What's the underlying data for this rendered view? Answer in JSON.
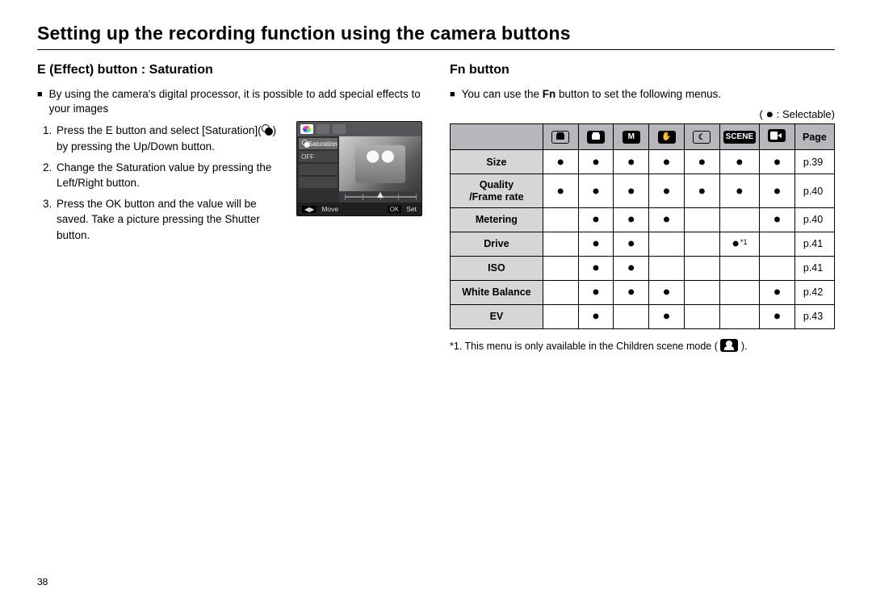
{
  "title": "Setting up the recording function using the camera buttons",
  "left": {
    "heading": "E (Effect) button : Saturation",
    "intro": "By using the camera's digital processor, it is possible to add special effects to your images",
    "steps": [
      "Press the E button and select [Saturation](   ) by pressing the Up/Down button.",
      "Change the Saturation value by pressing the Left/Right button.",
      "Press the OK button and the value will be saved. Take a picture pressing the Shutter button."
    ],
    "lcd": {
      "menu_label": "Saturation",
      "off_label": "OFF",
      "move_label": "Move",
      "ok_label": "OK",
      "set_label": "Set"
    }
  },
  "right": {
    "heading": "Fn button",
    "intro_pre": "You can use the ",
    "intro_bold": "Fn",
    "intro_post": " button to set the following menus.",
    "legend_label": " : Selectable",
    "page_label": "Page",
    "mode_icons": [
      "auto",
      "program",
      "manual",
      "dis",
      "night",
      "scene",
      "movie"
    ],
    "rows": [
      {
        "label": "Size",
        "dots": [
          true,
          true,
          true,
          true,
          true,
          true,
          true
        ],
        "page": "p.39"
      },
      {
        "label": "Quality\n/Frame rate",
        "dots": [
          true,
          true,
          true,
          true,
          true,
          true,
          true
        ],
        "page": "p.40"
      },
      {
        "label": "Metering",
        "dots": [
          false,
          true,
          true,
          true,
          false,
          false,
          true
        ],
        "page": "p.40"
      },
      {
        "label": "Drive",
        "dots": [
          false,
          true,
          true,
          false,
          false,
          "*1",
          false
        ],
        "page": "p.41"
      },
      {
        "label": "ISO",
        "dots": [
          false,
          true,
          true,
          false,
          false,
          false,
          false
        ],
        "page": "p.41"
      },
      {
        "label": "White Balance",
        "dots": [
          false,
          true,
          true,
          true,
          false,
          false,
          true
        ],
        "page": "p.42"
      },
      {
        "label": "EV",
        "dots": [
          false,
          true,
          false,
          true,
          false,
          false,
          true
        ],
        "page": "p.43"
      }
    ],
    "footnote": "*1. This menu is only available in the Children scene mode (   )."
  },
  "page_number": "38"
}
